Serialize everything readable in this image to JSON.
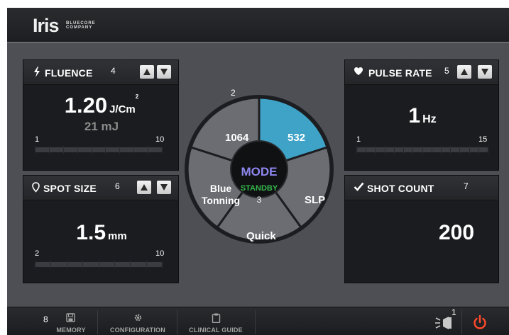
{
  "header": {
    "logo": "Iris",
    "logo_sub_line1": "BLUECORE",
    "logo_sub_line2": "COMPANY"
  },
  "fluence": {
    "title": "FLUENCE",
    "icon": "lightning-icon",
    "number_badge": "4",
    "value": "1.20",
    "unit": "J/Cm",
    "unit_sup": "2",
    "sub_value": "21 mJ",
    "scale_min": "1",
    "scale_max": "10"
  },
  "spot_size": {
    "title": "SPOT SIZE",
    "icon": "location-pin-icon",
    "number_badge": "6",
    "value": "1.5",
    "unit": "mm",
    "scale_min": "2",
    "scale_max": "10"
  },
  "pulse_rate": {
    "title": "PULSE RATE",
    "icon": "heart-icon",
    "number_badge": "5",
    "value": "1",
    "unit": "Hz",
    "scale_min": "1",
    "scale_max": "15"
  },
  "shot_count": {
    "title": "SHOT COUNT",
    "icon": "checkmark-icon",
    "number_badge": "7",
    "value": "200"
  },
  "mode_wheel": {
    "number_badge": "2",
    "segments": [
      {
        "label": "1064",
        "selected": false
      },
      {
        "label": "532",
        "selected": true
      },
      {
        "label": "SLP",
        "selected": false
      },
      {
        "label": "Quick",
        "selected": false
      },
      {
        "label_line1": "Blue",
        "label_line2": "Tonning",
        "selected": false
      }
    ],
    "center_title": "MODE",
    "center_status": "STANDBY",
    "center_number": "3"
  },
  "colors": {
    "selected_segment": "#3fa3c8",
    "segment": "#6b6d72",
    "mode_title": "#8d86ee",
    "standby": "#35b84a",
    "power": "#ff4a2a"
  },
  "footer": {
    "number_badge": "8",
    "memory_label": "MEMORY",
    "configuration_label": "CONFIGURATION",
    "clinical_guide_label": "CLINICAL GUIDE",
    "aim_number_badge": "1",
    "aim_icon": "aiming-beam-icon",
    "power_icon": "power-icon"
  }
}
